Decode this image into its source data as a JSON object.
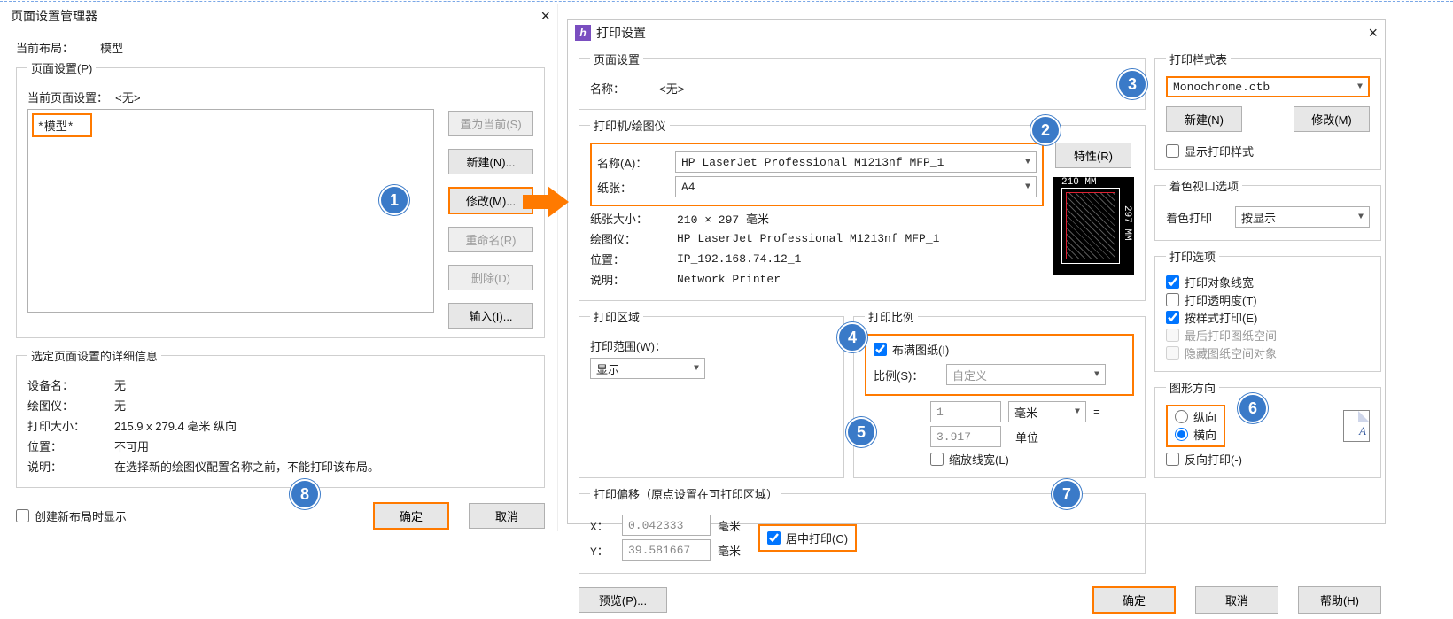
{
  "left": {
    "title": "页面设置管理器",
    "current_layout_label": "当前布局：",
    "current_layout_value": "模型",
    "page_setup_group": "页面设置(P)",
    "current_page_setup_label": "当前页面设置：",
    "current_page_setup_value": "<无>",
    "list_item": "*模型*",
    "btn_set_current": "置为当前(S)",
    "btn_new": "新建(N)...",
    "btn_modify": "修改(M)...",
    "btn_rename": "重命名(R)",
    "btn_delete": "删除(D)",
    "btn_import": "输入(I)...",
    "details_group": "选定页面设置的详细信息",
    "dev_label": "设备名：",
    "dev_value": "无",
    "plotter_label": "绘图仪：",
    "plotter_value": "无",
    "size_label": "打印大小：",
    "size_value": "215.9 x 279.4 毫米  纵向",
    "loc_label": "位置：",
    "loc_value": "不可用",
    "desc_label": "说明：",
    "desc_value": "在选择新的绘图仪配置名称之前，不能打印该布局。",
    "check_show": "创建新布局时显示",
    "btn_ok": "确定",
    "btn_cancel": "取消"
  },
  "right": {
    "title": "打印设置",
    "page_setup_group": "页面设置",
    "name_label": "名称：",
    "name_value": "<无>",
    "printer_group": "打印机/绘图仪",
    "printer_name_label": "名称(A)：",
    "printer_name_value": "HP LaserJet Professional M1213nf MFP_1",
    "paper_label": "纸张：",
    "paper_value": "A4",
    "btn_props": "特性(R)",
    "paper_size_label": "纸张大小：",
    "paper_size_value": "210 × 297  毫米",
    "plotter_label": "绘图仪：",
    "plotter_value": "HP LaserJet Professional M1213nf MFP_1",
    "loc_label": "位置：",
    "loc_value": "IP_192.168.74.12_1",
    "desc_label": "说明：",
    "desc_value": "Network Printer",
    "preview_w": "210 MM",
    "preview_h": "297 MM",
    "area_group": "打印区域",
    "area_label": "打印范围(W)：",
    "area_value": "显示",
    "scale_group": "打印比例",
    "scale_fit": "布满图纸(I)",
    "scale_label": "比例(S)：",
    "scale_value": "自定义",
    "scale_num": "1",
    "scale_unit": "毫米",
    "scale_eq": "=",
    "scale_num2": "3.917",
    "scale_unit2": "单位",
    "scale_lw": "缩放线宽(L)",
    "offset_group": "打印偏移（原点设置在可打印区域）",
    "off_x_label": "X：",
    "off_x": "0.042333",
    "off_unit": "毫米",
    "off_y_label": "Y：",
    "off_y": "39.581667",
    "off_center": "居中打印(C)",
    "style_group": "打印样式表",
    "style_value": "Monochrome.ctb",
    "style_new": "新建(N)",
    "style_modify": "修改(M)",
    "style_show": "显示打印样式",
    "shade_group": "着色视口选项",
    "shade_label": "着色打印",
    "shade_value": "按显示",
    "opt_group": "打印选项",
    "opt_lw": "打印对象线宽",
    "opt_trans": "打印透明度(T)",
    "opt_styles": "按样式打印(E)",
    "opt_last": "最后打印图纸空间",
    "opt_hide": "隐藏图纸空间对象",
    "orient_group": "图形方向",
    "orient_port": "纵向",
    "orient_land": "横向",
    "orient_rev": "反向打印(-)",
    "btn_preview": "预览(P)...",
    "btn_ok": "确定",
    "btn_cancel": "取消",
    "btn_help": "帮助(H)"
  },
  "annotations": {
    "1": "1",
    "2": "2",
    "3": "3",
    "4": "4",
    "5": "5",
    "6": "6",
    "7": "7",
    "8": "8"
  }
}
